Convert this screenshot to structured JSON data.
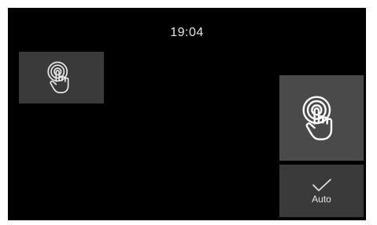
{
  "status_bar": {
    "time": "19:04"
  },
  "tiles": {
    "touch_small": {
      "icon": "touch-hand-icon"
    },
    "touch_large": {
      "icon": "touch-hand-icon"
    },
    "auto": {
      "icon": "checkmark-icon",
      "label": "Auto"
    }
  },
  "colors": {
    "screen_bg": "#000000",
    "tile_bg": "#3a3a3a",
    "tile_active_bg": "#4a4a4a",
    "foreground": "#e6e6e6"
  }
}
